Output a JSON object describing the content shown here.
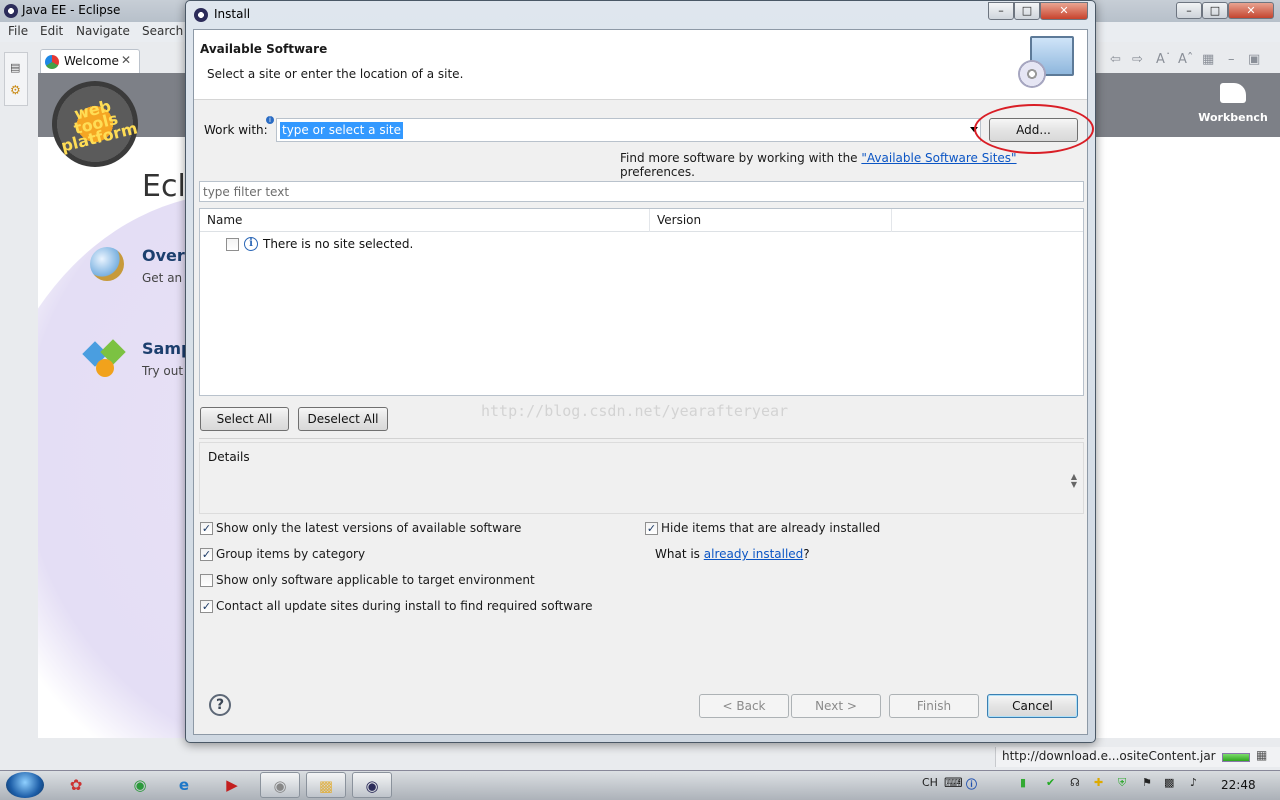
{
  "eclipse": {
    "title": "Java EE - Eclipse",
    "menu": [
      "File",
      "Edit",
      "Navigate",
      "Search"
    ],
    "welcome_tab": "Welcome",
    "welcome_title": "Ecl",
    "overview_title": "Over",
    "overview_desc": "Get an",
    "samples_title": "Samp",
    "samples_desc": "Try out",
    "logo_text": "web tools platform",
    "workbench_label": "Workbench",
    "status_text": "http://download.e...ositeContent.jar"
  },
  "dialog": {
    "title": "Install",
    "header_title": "Available Software",
    "header_subtitle": "Select a site or enter the location of a site.",
    "work_with_label": "Work with:",
    "work_with_value": "type or select a site",
    "add_button": "Add...",
    "find_more_prefix": "Find more software by working with the ",
    "find_more_link": "\"Available Software Sites\"",
    "find_more_suffix": " preferences.",
    "filter_placeholder": "type filter text",
    "columns": [
      "Name",
      "Version"
    ],
    "empty_row": "There is no site selected.",
    "select_all": "Select All",
    "deselect_all": "Deselect All",
    "details_label": "Details",
    "options": {
      "latest_versions": {
        "label": "Show only the latest versions of available software",
        "checked": true
      },
      "group_by_category": {
        "label": "Group items by category",
        "checked": true
      },
      "target_env": {
        "label": "Show only software applicable to target environment",
        "checked": false
      },
      "contact_sites": {
        "label": "Contact all update sites during install to find required software",
        "checked": true
      },
      "hide_installed": {
        "label": "Hide items that are already installed",
        "checked": true
      }
    },
    "what_is_prefix": "What is ",
    "what_is_link": "already installed",
    "what_is_suffix": "?",
    "back_button": "< Back",
    "next_button": "Next >",
    "finish_button": "Finish",
    "cancel_button": "Cancel"
  },
  "watermark": "http://blog.csdn.net/yearafteryear",
  "taskbar": {
    "lang": "CH",
    "clock": "22:48"
  },
  "colors": {
    "selection": "#3399ff",
    "link": "#0b55c4",
    "highlight_ring": "#d91e26"
  }
}
